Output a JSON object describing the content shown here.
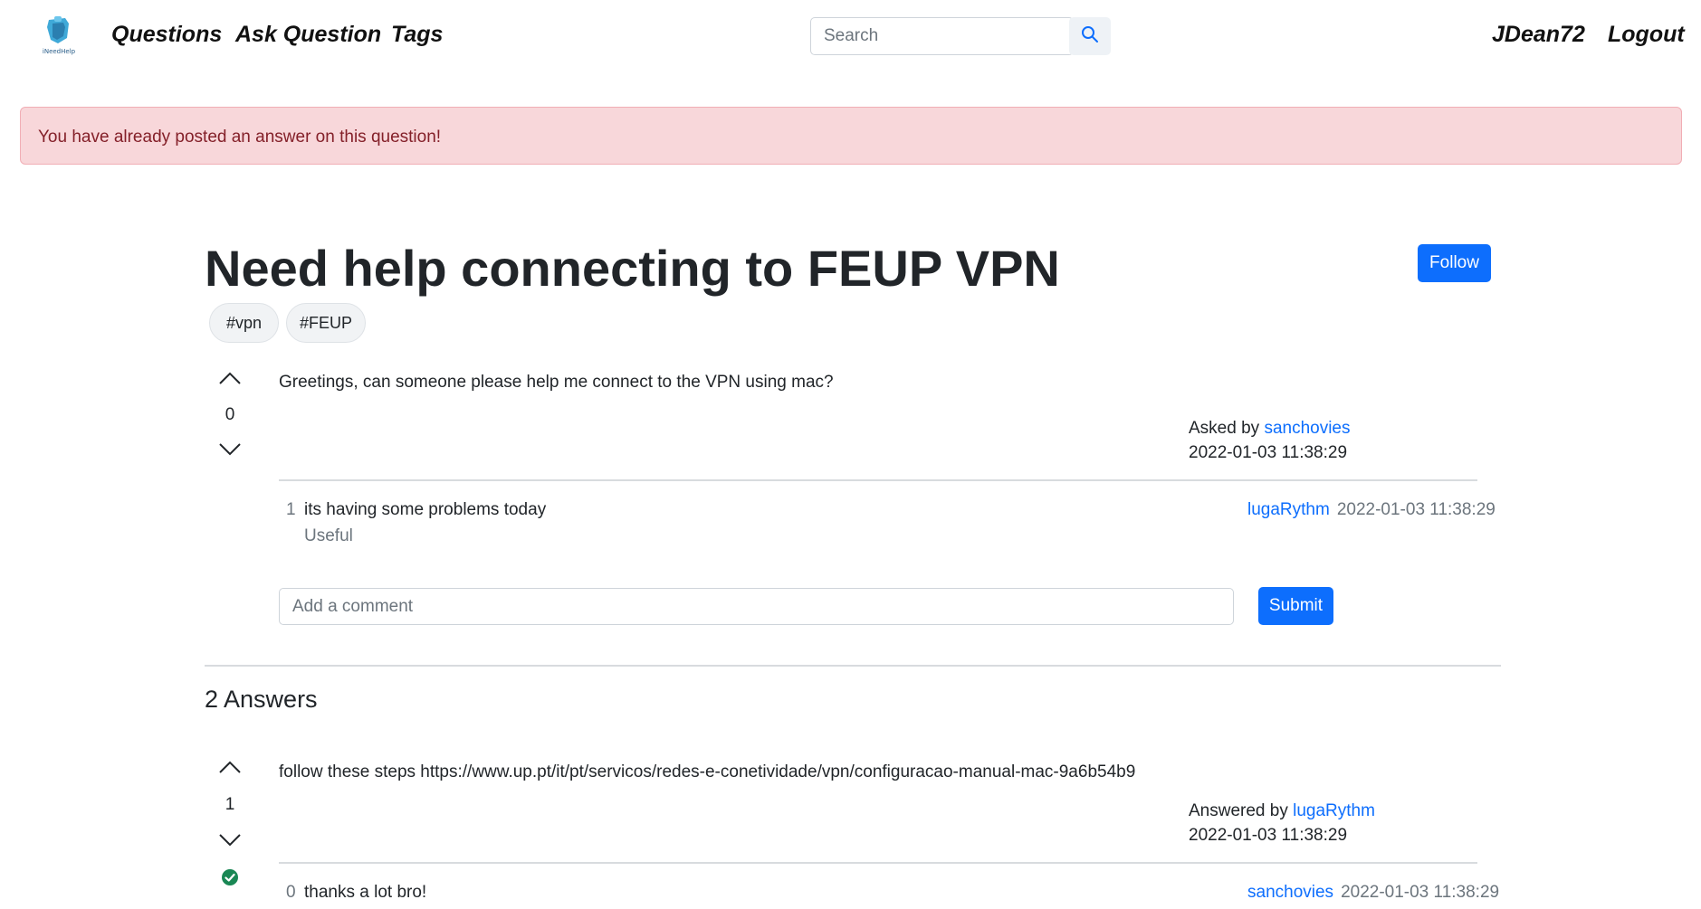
{
  "nav": {
    "logo_text": "iNeedHelp",
    "links": [
      "Questions",
      "Ask Question",
      "Tags"
    ],
    "search_placeholder": "Search",
    "username": "JDean72",
    "logout": "Logout"
  },
  "alert": {
    "message": "You have already posted an answer on this question!"
  },
  "question": {
    "title": "Need help connecting to FEUP VPN",
    "follow_label": "Follow",
    "tags": [
      "#vpn",
      "#FEUP"
    ],
    "votes": "0",
    "body": "Greetings, can someone please help me connect to the VPN using mac?",
    "asked_prefix": "Asked by",
    "author": "sanchovies",
    "date": "2022-01-03 11:38:29",
    "comments": [
      {
        "score": "1",
        "text": "its having some problems today",
        "author": "lugaRythm",
        "date": "2022-01-03 11:38:29",
        "useful_label": "Useful"
      }
    ],
    "comment_placeholder": "Add a comment",
    "submit_label": "Submit"
  },
  "answers_heading": "2 Answers",
  "answers": [
    {
      "votes": "1",
      "body": "follow these steps https://www.up.pt/it/pt/servicos/redes-e-conetividade/vpn/configuracao-manual-mac-9a6b54b9",
      "answered_prefix": "Answered by",
      "author": "lugaRythm",
      "date": "2022-01-03 11:38:29",
      "accepted": true,
      "comments": [
        {
          "score": "0",
          "text": "thanks a lot bro!",
          "author": "sanchovies",
          "date": "2022-01-03 11:38:29"
        }
      ]
    }
  ],
  "colors": {
    "primary": "#0d6efd",
    "alert_bg": "#f8d7da",
    "alert_text": "#842029",
    "accepted": "#198754"
  },
  "icons": [
    "logo-icon",
    "search-icon",
    "upvote-icon",
    "downvote-icon",
    "accepted-check-icon"
  ]
}
